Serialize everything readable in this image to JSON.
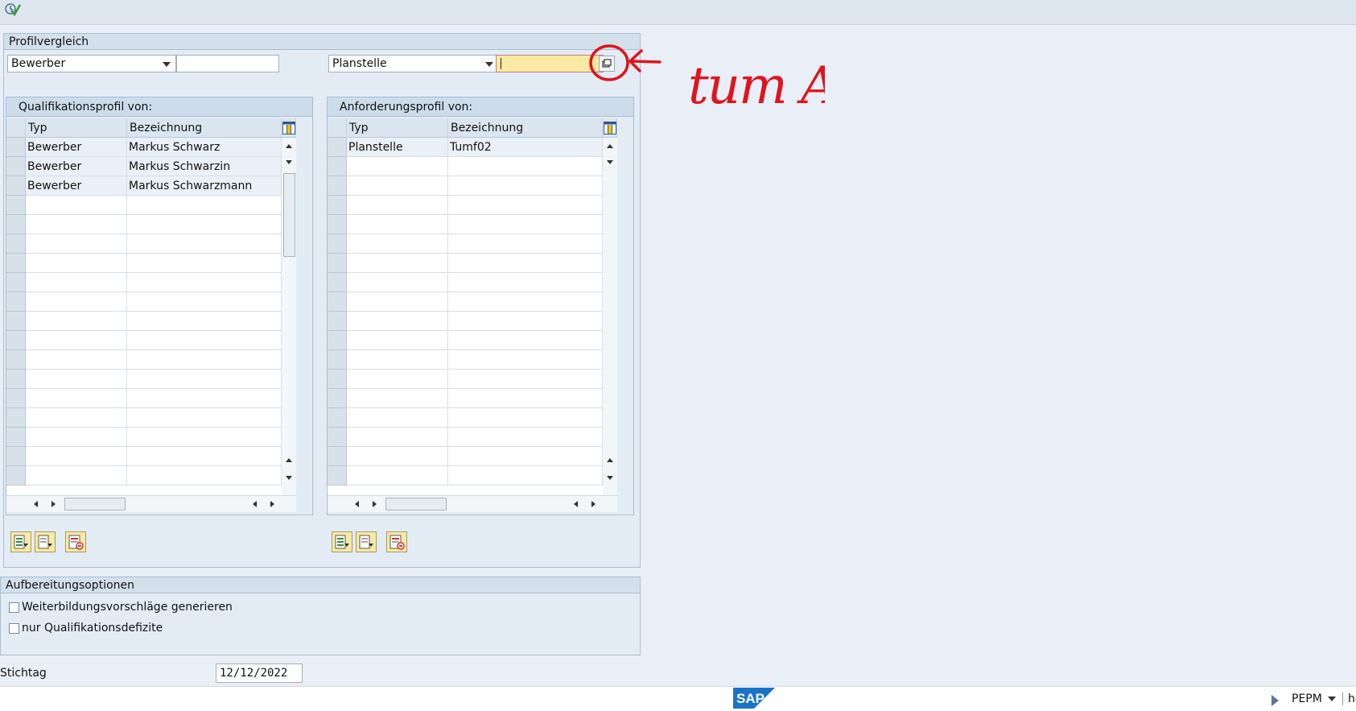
{
  "profile_compare": {
    "title": "Profilvergleich",
    "left_type": "Bewerber",
    "left_value": "",
    "right_type": "Planstelle",
    "right_value": ""
  },
  "qualification_panel": {
    "title": "Qualifikationsprofil von:",
    "columns": [
      "Typ",
      "Bezeichnung"
    ],
    "rows": [
      {
        "typ": "Bewerber",
        "bezeichnung": "Markus Schwarz"
      },
      {
        "typ": "Bewerber",
        "bezeichnung": "Markus Schwarzin"
      },
      {
        "typ": "Bewerber",
        "bezeichnung": "Markus Schwarzmann"
      }
    ]
  },
  "requirement_panel": {
    "title": "Anforderungsprofil von:",
    "columns": [
      "Typ",
      "Bezeichnung"
    ],
    "rows": [
      {
        "typ": "Planstelle",
        "bezeichnung": "Tumf02"
      }
    ]
  },
  "options": {
    "title": "Aufbereitungsoptionen",
    "checkbox1": "Weiterbildungsvorschläge generieren",
    "checkbox2": "nur Qualifikationsdefizite"
  },
  "key_date": {
    "label": "Stichtag",
    "value": "12/12/2022"
  },
  "annotation": {
    "text": "tum A",
    "color": "#e0141c"
  },
  "status": {
    "logo": "SAP",
    "system": "PEPM",
    "extra": "ha"
  },
  "colors": {
    "accent_yellow": "#fbe9a4",
    "annotation_red": "#e0141c"
  }
}
